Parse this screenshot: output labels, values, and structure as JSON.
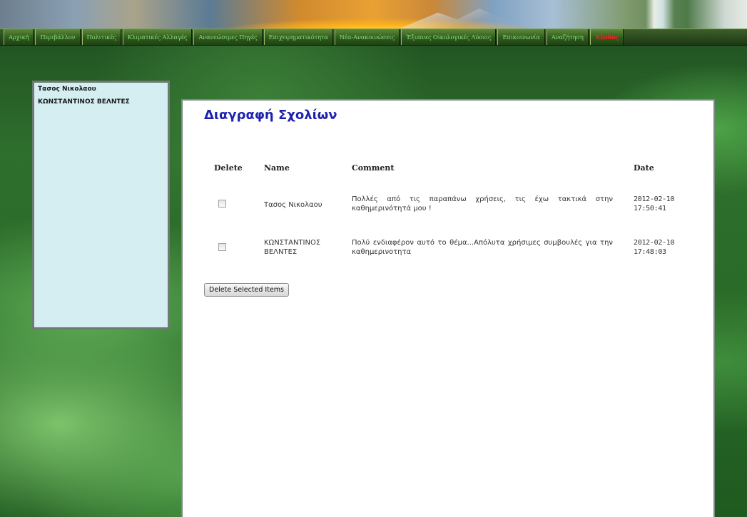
{
  "nav": {
    "items": [
      {
        "label": "Αρχική"
      },
      {
        "label": "Περιβάλλον"
      },
      {
        "label": "Πολιτικές"
      },
      {
        "label": "Κλιματικές Αλλαγές"
      },
      {
        "label": "Ανανεώσιμες Πηγές"
      },
      {
        "label": "Επιχειρηματικότητα"
      },
      {
        "label": "Νέα-Ανακοινώσεις"
      },
      {
        "label": "Έξυπνες Οικολογικές Λύσεις"
      },
      {
        "label": "Επικοινωνία"
      },
      {
        "label": "Αναζήτηση"
      },
      {
        "label": "Έξοδος"
      }
    ],
    "active_color": "#ff2020"
  },
  "sidebar": {
    "items": [
      {
        "label": "Τασος Νικολαου"
      },
      {
        "label": "ΚΩΝΣΤΑΝΤΙΝΟΣ ΒΕΛΝΤΕΣ"
      }
    ]
  },
  "main": {
    "title": "Διαγραφή Σχολίων",
    "table": {
      "headers": [
        "Delete",
        "Name",
        "Comment",
        "Date"
      ],
      "rows": [
        {
          "checked": false,
          "name": "Τασος Νικολαου",
          "comment": "Πολλές από τις παραπάνω χρήσεις, τις έχω τακτικά στην καθημερινότητά μου !",
          "date": "2012-02-10",
          "time": "17:50:41"
        },
        {
          "checked": false,
          "name": "ΚΩΝΣΤΑΝΤΙΝΟΣ ΒΕΛΝΤΕΣ",
          "comment": "Πολύ ενδιαφέρον αυτό το θέμα...Απόλυτα χρήσιμες συμβουλές για την καθημερινοτητα",
          "date": "2012-02-10",
          "time": "17:48:03"
        }
      ]
    },
    "delete_button_label": "Delete Selected Items"
  },
  "colors": {
    "title": "#1e22b0",
    "sidebar_bg": "#d4eef1",
    "nav_text": "#8be07e"
  }
}
